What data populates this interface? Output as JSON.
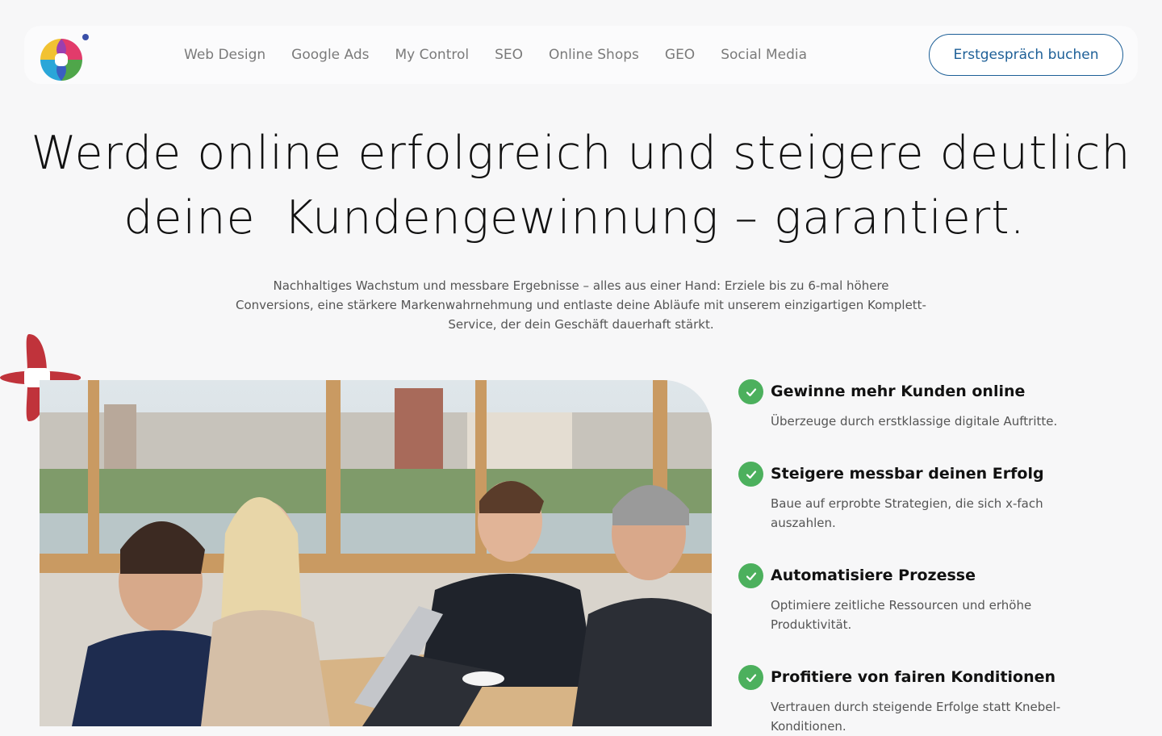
{
  "nav": {
    "items": [
      "Web Design",
      "Google Ads",
      "My Control",
      "SEO",
      "Online Shops",
      "GEO",
      "Social Media"
    ],
    "cta_label": "Erstgespräch buchen"
  },
  "hero": {
    "title_line1": "Werde online erfolgreich und steigere deutlich",
    "title_line2_prefix": "deine",
    "title_highlight": "Kundengewinnung – garantiert.",
    "subtitle": "Nachhaltiges Wachstum und messbare Ergebnisse – alles aus einer Hand: Erziele bis zu 6-mal höhere Conversions, eine stärkere Markenwahrnehmung und entlaste deine Abläufe mit unserem einzigartigen Komplett-Service, der dein Geschäft dauerhaft stärkt."
  },
  "features": [
    {
      "title": "Gewinne mehr Kunden online",
      "text": "Überzeuge durch erstklassige digitale Auftritte."
    },
    {
      "title": "Steigere messbar deinen Erfolg",
      "text": "Baue auf erprobte Strategien, die sich x-fach auszahlen."
    },
    {
      "title": "Automatisiere Prozesse",
      "text": "Optimiere zeitliche Ressourcen und erhöhe Produktivität."
    },
    {
      "title": "Profitiere von fairen Konditionen",
      "text": "Vertrauen durch steigende Erfolge statt Knebel-Konditionen."
    }
  ],
  "colors": {
    "accent_blue": "#1d5f97",
    "highlight_yellow": "#f2bd2e",
    "check_green": "#4cb05d",
    "deco_red": "#c0333b"
  },
  "icons": [
    "logo-icon",
    "check-icon",
    "star-deco-icon"
  ]
}
